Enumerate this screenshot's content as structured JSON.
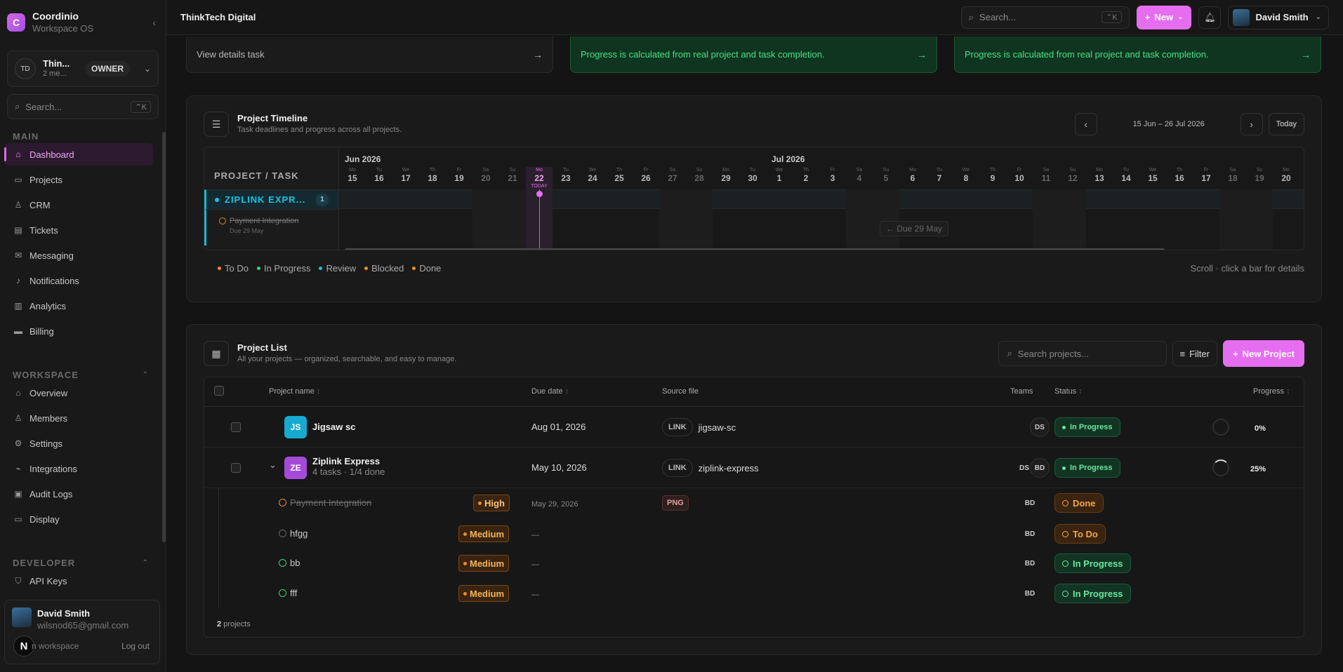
{
  "brand": {
    "name": "Coordinio",
    "subtitle": "Workspace OS",
    "logo": "C"
  },
  "workspace": {
    "initials": "TD",
    "name": "Thin...",
    "sub": "2 me...",
    "role": "OWNER"
  },
  "sidebar_search": {
    "placeholder": "Search...",
    "shortcut": "⌃K"
  },
  "nav": {
    "main_label": "MAIN",
    "main": [
      {
        "label": "Dashboard",
        "icon": "home-icon"
      },
      {
        "label": "Projects",
        "icon": "folder-icon"
      },
      {
        "label": "CRM",
        "icon": "users-icon"
      },
      {
        "label": "Tickets",
        "icon": "ticket-icon"
      },
      {
        "label": "Messaging",
        "icon": "mail-icon"
      },
      {
        "label": "Notifications",
        "icon": "bell-icon"
      },
      {
        "label": "Analytics",
        "icon": "chart-icon"
      },
      {
        "label": "Billing",
        "icon": "card-icon"
      }
    ],
    "workspace_label": "WORKSPACE",
    "workspace": [
      {
        "label": "Overview",
        "icon": "home-icon"
      },
      {
        "label": "Members",
        "icon": "users-icon"
      },
      {
        "label": "Settings",
        "icon": "gear-icon"
      },
      {
        "label": "Integrations",
        "icon": "plug-icon"
      },
      {
        "label": "Audit Logs",
        "icon": "clipboard-icon"
      },
      {
        "label": "Display",
        "icon": "monitor-icon"
      }
    ],
    "developer_label": "DEVELOPER",
    "developer": [
      {
        "label": "API Keys",
        "icon": "shield-icon"
      }
    ]
  },
  "user": {
    "name": "David Smith",
    "email": "wilsnod65@gmail.com",
    "switch_label": "n workspace",
    "logout_label": "Log out",
    "badge": "N"
  },
  "topbar": {
    "title": "ThinkTech Digital",
    "search_placeholder": "Search...",
    "search_shortcut": "⌃K",
    "new_label": "New",
    "user_name": "David Smith"
  },
  "cards": {
    "view_details": "View details task",
    "progress_note_1": "Progress is calculated from real project and task completion.",
    "progress_note_2": "Progress is calculated from real project and task completion."
  },
  "timeline": {
    "title": "Project Timeline",
    "subtitle": "Task deadlines and progress across all projects.",
    "range": "15 Jun – 26 Jul 2026",
    "today_label": "Today",
    "left_header": "PROJECT / TASK",
    "months": [
      "Jun 2026",
      "Jul 2026"
    ],
    "days": [
      {
        "wd": "Mo",
        "d": "15"
      },
      {
        "wd": "Tu",
        "d": "16"
      },
      {
        "wd": "We",
        "d": "17"
      },
      {
        "wd": "Th",
        "d": "18"
      },
      {
        "wd": "Fr",
        "d": "19"
      },
      {
        "wd": "Sa",
        "d": "20"
      },
      {
        "wd": "Su",
        "d": "21"
      },
      {
        "wd": "Mo",
        "d": "22"
      },
      {
        "wd": "Tu",
        "d": "23"
      },
      {
        "wd": "We",
        "d": "24"
      },
      {
        "wd": "Th",
        "d": "25"
      },
      {
        "wd": "Fr",
        "d": "26"
      },
      {
        "wd": "Sa",
        "d": "27"
      },
      {
        "wd": "Su",
        "d": "28"
      },
      {
        "wd": "Mo",
        "d": "29"
      },
      {
        "wd": "Tu",
        "d": "30"
      },
      {
        "wd": "We",
        "d": "1"
      },
      {
        "wd": "Th",
        "d": "2"
      },
      {
        "wd": "Fr",
        "d": "3"
      },
      {
        "wd": "Sa",
        "d": "4"
      },
      {
        "wd": "Su",
        "d": "5"
      },
      {
        "wd": "Mo",
        "d": "6"
      },
      {
        "wd": "Tu",
        "d": "7"
      },
      {
        "wd": "We",
        "d": "8"
      },
      {
        "wd": "Th",
        "d": "9"
      },
      {
        "wd": "Fr",
        "d": "10"
      },
      {
        "wd": "Sa",
        "d": "11"
      },
      {
        "wd": "Su",
        "d": "12"
      },
      {
        "wd": "Mo",
        "d": "13"
      },
      {
        "wd": "Tu",
        "d": "14"
      },
      {
        "wd": "We",
        "d": "15"
      },
      {
        "wd": "Th",
        "d": "16"
      },
      {
        "wd": "Fr",
        "d": "17"
      },
      {
        "wd": "Sa",
        "d": "18"
      },
      {
        "wd": "Su",
        "d": "19"
      },
      {
        "wd": "Mo",
        "d": "20"
      }
    ],
    "today_tag": "TODAY",
    "project": {
      "name": "ZIPLINK EXPR...",
      "count": "1"
    },
    "task": {
      "name": "Payment Integration",
      "due": "Due 29 May"
    },
    "due_chip": "← Due 29 May",
    "legend": [
      {
        "label": "To Do",
        "color": "#f08a2a"
      },
      {
        "label": "In Progress",
        "color": "#3ad07a"
      },
      {
        "label": "Review",
        "color": "#19c2e4"
      },
      {
        "label": "Blocked",
        "color": "#f08a2a"
      },
      {
        "label": "Done",
        "color": "#f08a2a"
      }
    ],
    "hint": "Scroll · click a bar for details"
  },
  "project_list": {
    "title": "Project List",
    "subtitle": "All your projects — organized, searchable, and easy to manage.",
    "search_placeholder": "Search projects...",
    "filter_label": "Filter",
    "new_label": "New Project",
    "columns": {
      "name": "Project name",
      "due": "Due date",
      "source": "Source file",
      "teams": "Teams",
      "status": "Status",
      "progress": "Progress"
    },
    "projects": [
      {
        "initials": "JS",
        "color": "#17a9cf",
        "name": "Jigsaw sc",
        "meta": "",
        "due": "Aug 01, 2026",
        "source_type": "LINK",
        "source": "jigsaw-sc",
        "teams": [
          "DS"
        ],
        "status": "In Progress",
        "progress": "0%"
      },
      {
        "initials": "ZE",
        "color": "#a54ad8",
        "name": "Ziplink Express",
        "meta": "4 tasks · 1/4 done",
        "due": "May 10, 2026",
        "source_type": "LINK",
        "source": "ziplink-express",
        "teams": [
          "DS",
          "BD"
        ],
        "status": "In Progress",
        "progress": "25%"
      }
    ],
    "tasks": [
      {
        "name": "Payment Integration",
        "priority": "High",
        "due": "May 29, 2026",
        "file": "PNG",
        "team": "BD",
        "status": "Done"
      },
      {
        "name": "hfgg",
        "priority": "Medium",
        "due": "—",
        "file": "",
        "team": "BD",
        "status": "To Do"
      },
      {
        "name": "bb",
        "priority": "Medium",
        "due": "—",
        "file": "",
        "team": "BD",
        "status": "In Progress"
      },
      {
        "name": "fff",
        "priority": "Medium",
        "due": "—",
        "file": "",
        "team": "BD",
        "status": "In Progress"
      }
    ],
    "footer_count": "2",
    "footer_label": "projects"
  }
}
